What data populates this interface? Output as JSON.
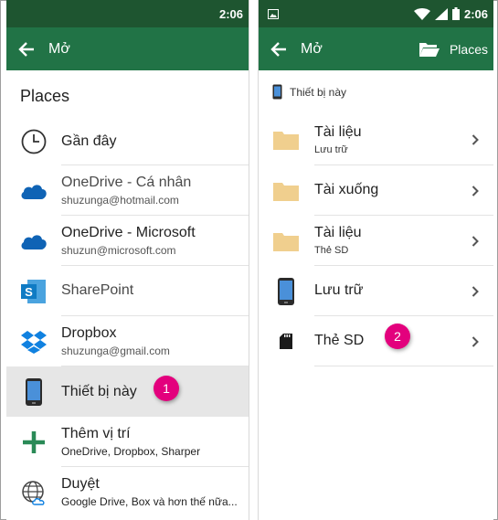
{
  "status_time": "2:06",
  "left": {
    "toolbar_title": "Mở",
    "section_title": "Places",
    "items": [
      {
        "main": "Gần đây",
        "sub": ""
      },
      {
        "main": "OneDrive -  Cá nhân",
        "sub": "shuzunga@hotmail.com"
      },
      {
        "main": "OneDrive - Microsoft",
        "sub": "shuzun@microsoft.com"
      },
      {
        "main": "SharePoint",
        "sub": ""
      },
      {
        "main": "Dropbox",
        "sub": "shuzunga@gmail.com"
      },
      {
        "main": "Thiết bị này",
        "sub": ""
      },
      {
        "main": "Thêm vị trí",
        "sub": "OneDrive, Dropbox, Sharper"
      },
      {
        "main": "Duyệt",
        "sub": "Google Drive, Box và hơn thế nữa..."
      }
    ],
    "badge": "1"
  },
  "right": {
    "toolbar_title": "Mở",
    "places_label": "Places",
    "breadcrumb": "Thiết bị này",
    "items": [
      {
        "main": "Tài liệu",
        "sub": "Lưu trữ"
      },
      {
        "main": "Tài xuống",
        "sub": ""
      },
      {
        "main": "Tài liệu",
        "sub": "Thẻ SD"
      },
      {
        "main": "Lưu trữ",
        "sub": ""
      },
      {
        "main": "Thẻ SD",
        "sub": ""
      }
    ],
    "badge": "2"
  },
  "colors": {
    "status_bar": "#1e5530",
    "toolbar": "#217346",
    "badge": "#e3007d",
    "folder": "#f0cf8e",
    "onedrive": "#0f63b5",
    "sharepoint": "#0f7bc4",
    "dropbox": "#1081e0",
    "add": "#2a8a57"
  },
  "icons": {
    "back": "arrow-left-icon",
    "recent": "clock-icon",
    "onedrive": "cloud-icon",
    "sharepoint": "sharepoint-icon",
    "dropbox": "dropbox-icon",
    "device": "phone-icon",
    "add": "plus-icon",
    "browse": "globe-icon",
    "folder": "folder-icon",
    "sd": "sd-card-icon",
    "chevron": "chevron-right-icon"
  }
}
